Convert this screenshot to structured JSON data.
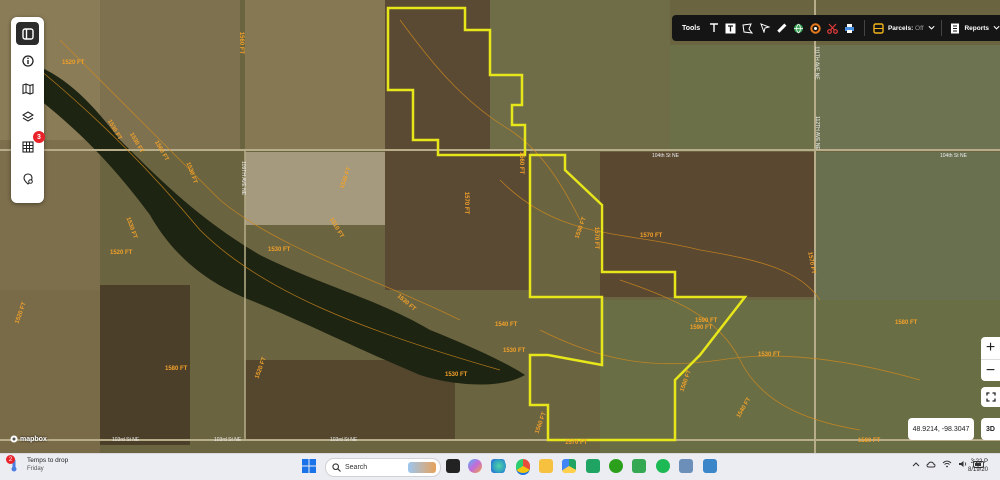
{
  "toolbar": {
    "tools_label": "Tools",
    "parcels_label": "Parcels:",
    "parcels_state": "Off",
    "reports_label": "Reports"
  },
  "sidebar": {
    "layers_badge": "3"
  },
  "map": {
    "coordinates": "48.9214, -98.3047",
    "btn_3d": "3D",
    "attribution": "mapbox",
    "roads": {
      "st_104th_left": "104th St NE",
      "st_104th_right": "104th St NE",
      "st_103rd_a": "103rd St NE",
      "st_103rd_b": "103rd St NE",
      "st_103rd_c": "103rd St NE",
      "ave_111th": "111TH AVE NE",
      "ave_112th": "112TH AVE NE",
      "ave_109th": "109TH AVE NE"
    },
    "contours": [
      "1520 FT",
      "1530 FT",
      "1530 FT",
      "1560 FT",
      "1530 FT",
      "1560 FT",
      "1520 FT",
      "1530 FT",
      "1510 FT",
      "1530 FT",
      "1570 FT",
      "1530 FT",
      "1570 FT",
      "1570 FT",
      "1580 FT",
      "1590 FT",
      "1530 FT",
      "1540 FT",
      "1560 FT",
      "1570 FT",
      "1580 FT",
      "1530 FT",
      "1530 FT",
      "1520 FT",
      "1520 FT",
      "1580 FT",
      "1590 FT",
      "1560 FT",
      "1530 FT",
      "1580 FT",
      "1570 FT",
      "1540 FT",
      "1530 FT"
    ]
  },
  "taskbar": {
    "weather_badge": "2",
    "weather_title": "Temps to drop",
    "weather_sub": "Friday",
    "search_placeholder": "Search",
    "time": "3:22 P",
    "date": "8/19/20"
  }
}
